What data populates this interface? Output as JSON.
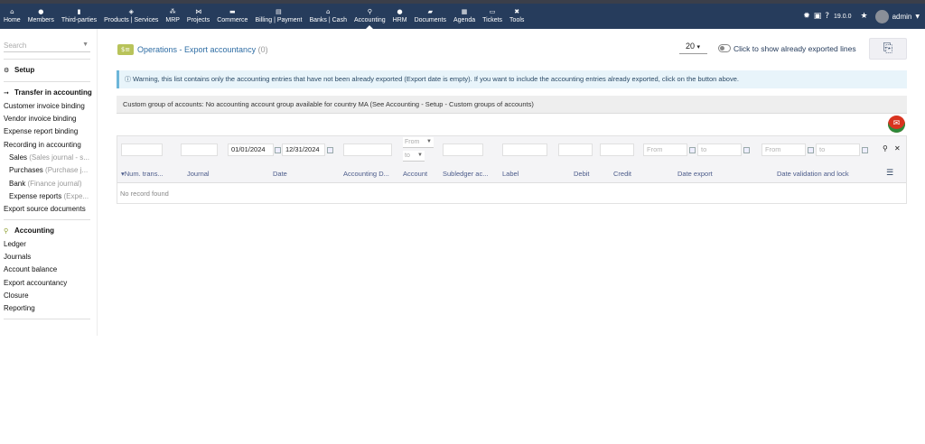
{
  "topbar": {
    "menu": [
      {
        "label": "Home",
        "icon": "home-icon",
        "glyph": "⌂"
      },
      {
        "label": "Members",
        "icon": "members-icon",
        "glyph": "●"
      },
      {
        "label": "Third-parties",
        "icon": "building-icon",
        "glyph": "▮"
      },
      {
        "label": "Products | Services",
        "icon": "cube-icon",
        "glyph": "◈"
      },
      {
        "label": "MRP",
        "icon": "cubes-icon",
        "glyph": "⁂"
      },
      {
        "label": "Projects",
        "icon": "sitemap-icon",
        "glyph": "⋈"
      },
      {
        "label": "Commerce",
        "icon": "briefcase-icon",
        "glyph": "▬"
      },
      {
        "label": "Billing | Payment",
        "icon": "invoice-icon",
        "glyph": "▤"
      },
      {
        "label": "Banks | Cash",
        "icon": "bank-icon",
        "glyph": "⌂"
      },
      {
        "label": "Accounting",
        "icon": "search-dollar-icon",
        "glyph": "⚲"
      },
      {
        "label": "HRM",
        "icon": "user-tie-icon",
        "glyph": "●"
      },
      {
        "label": "Documents",
        "icon": "folder-icon",
        "glyph": "▰"
      },
      {
        "label": "Agenda",
        "icon": "calendar-icon",
        "glyph": "▦"
      },
      {
        "label": "Tickets",
        "icon": "ticket-icon",
        "glyph": "▭"
      },
      {
        "label": "Tools",
        "icon": "tools-icon",
        "glyph": "✖"
      }
    ],
    "active": "Accounting",
    "version": "19.0.0",
    "user": "admin",
    "right_icons": [
      "bug-icon",
      "print-icon",
      "help-icon",
      "star-icon"
    ]
  },
  "sidebar": {
    "search_placeholder": "Search",
    "setup": "Setup",
    "transfer_title": "Transfer in accounting",
    "customer_binding": "Customer invoice binding",
    "vendor_binding": "Vendor invoice binding",
    "expense_binding": "Expense report binding",
    "recording": "Recording in accounting",
    "sales": "Sales",
    "sales_journal": "(Sales journal - s...",
    "purchases": "Purchases",
    "purchases_journal": "(Purchase j...",
    "bank": "Bank",
    "bank_journal": "(Finance journal)",
    "expense_reports": "Expense reports",
    "expense_journal": "(Expe...",
    "export_source": "Export source documents",
    "accounting_title": "Accounting",
    "ledger": "Ledger",
    "journals": "Journals",
    "account_balance": "Account balance",
    "export_accountancy": "Export accountancy",
    "closure": "Closure",
    "reporting": "Reporting"
  },
  "main": {
    "title": "Operations - Export accountancy",
    "count": "(0)",
    "limit": "20",
    "toggle_label": "Click to show already exported lines",
    "warning": "Warning, this list contains only the accounting entries that have not been already exported (Export date is empty). If you want to include the accounting entries already exported, click on the button above.",
    "group_info": "Custom group of accounts: No accounting account group available for country MA (See Accounting - Setup - Custom groups of accounts)"
  },
  "table": {
    "filters": {
      "date_from": "01/01/2024",
      "date_to": "12/31/2024",
      "from": "From",
      "to": "to"
    },
    "headers": {
      "num": "Num. trans...",
      "journal": "Journal",
      "date": "Date",
      "accounting_doc": "Accounting D...",
      "account": "Account",
      "subledger": "Subledger ac...",
      "label": "Label",
      "debit": "Debit",
      "credit": "Credit",
      "date_export": "Date export",
      "date_validation": "Date validation and lock"
    },
    "empty": "No record found"
  },
  "colors": {
    "topbar": "#263c5c",
    "link": "#2e6da4",
    "warning_bg": "#e8f4fa",
    "warning_border": "#6db6d9",
    "header_text": "#4b5b8a"
  }
}
